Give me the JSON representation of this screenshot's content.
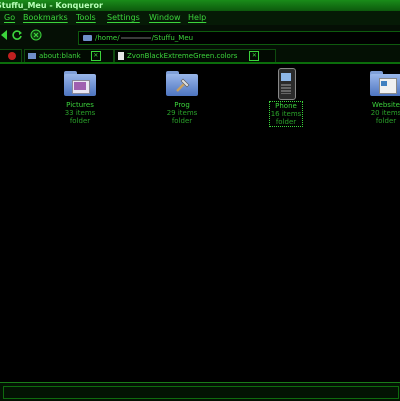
{
  "window": {
    "title": "Stuffu_Meu - Konqueror"
  },
  "menu": [
    "Go",
    "Bookmarks",
    "Tools",
    "Settings",
    "Window",
    "Help"
  ],
  "location": {
    "path_prefix": "/home/",
    "path_suffix": "/Stuffu_Meu"
  },
  "tabs": [
    {
      "label": "about:blank"
    },
    {
      "label": "ZvonBlackExtremeGreen.colors"
    }
  ],
  "items": [
    {
      "name": "Pictures",
      "count": "33 items",
      "kind": "folder",
      "icon": "pictures-folder-icon"
    },
    {
      "name": "Prog",
      "count": "29 items",
      "kind": "folder",
      "icon": "tools-folder-icon"
    },
    {
      "name": "Phone",
      "count": "16 items",
      "kind": "folder",
      "icon": "phone-folder-icon"
    },
    {
      "name": "Website",
      "count": "20 items",
      "kind": "folder",
      "icon": "website-folder-icon"
    }
  ],
  "colors": {
    "accent": "#3cd43c",
    "background": "#000000",
    "folder": "#6f8fc8"
  }
}
